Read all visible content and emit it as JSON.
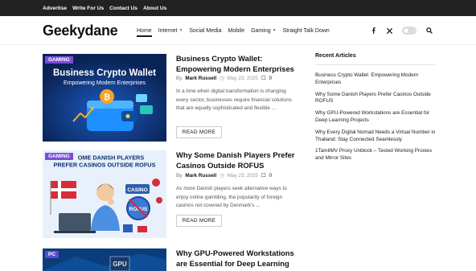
{
  "topbar": {
    "links": [
      "Advertise",
      "Write For Us",
      "Contact Us",
      "About Us"
    ]
  },
  "header": {
    "logo": "Geekydane",
    "nav": [
      {
        "label": "Home",
        "active": true,
        "dropdown": false
      },
      {
        "label": "Internet",
        "active": false,
        "dropdown": true
      },
      {
        "label": "Social Media",
        "active": false,
        "dropdown": false
      },
      {
        "label": "Mobile",
        "active": false,
        "dropdown": false
      },
      {
        "label": "Gaming",
        "active": false,
        "dropdown": true
      },
      {
        "label": "Straight Talk Down",
        "active": false,
        "dropdown": false
      }
    ],
    "icons": [
      "facebook-icon",
      "x-icon",
      "theme-toggle",
      "search-icon"
    ]
  },
  "posts": [
    {
      "category": "GAMING",
      "thumb_heading": "Business Crypto Wallet",
      "thumb_sub": "Empowering Modern Enterprises",
      "title": "Business Crypto Wallet: Empowering Modern Enterprises",
      "by": "By",
      "author": "Mark Russell",
      "date": "May 23, 2025",
      "comments": "0",
      "excerpt": "In a time when digital transformation is changing every sector, businesses require financial solutions that are equally sophisticated and flexible ...",
      "read_more": "READ MORE"
    },
    {
      "category": "GAMING",
      "thumb_heading": "OME DANISH PLAYERS PREFER CASINOS OUTSIDE ROFUS",
      "thumb_badge": "CASINO",
      "thumb_badge2": "ROFUS",
      "title": "Why Some Danish Players Prefer Casinos Outside ROFUS",
      "by": "By",
      "author": "Mark Russell",
      "date": "May 23, 2025",
      "comments": "0",
      "excerpt": "As more Danish players seek alternative ways to enjoy online gambling, the popularity of foreign casinos not covered by Denmark's ...",
      "read_more": "READ MORE"
    },
    {
      "category": "PC",
      "thumb_label": "GPU",
      "title": "Why GPU-Powered Workstations are Essential for Deep Learning"
    }
  ],
  "sidebar": {
    "title": "Recent Articles",
    "items": [
      "Business Crypto Wallet: Empowering Modern Enterprises",
      "Why Some Danish Players Prefer Casinos Outside ROFUS",
      "Why GPU-Powered Workstations are Essential for Deep Learning Projects",
      "Why Every Digital Nomad Needs a Virtual Number in Thailand: Stay Connected Seamlessly",
      "1TamilMV Proxy Unblock – Tested Working Proxies and Mirror Sites"
    ]
  },
  "colors": {
    "topbar_bg": "#222222",
    "category_badge": "#7b4dd6",
    "thumb1_bg": "#0f2f6b",
    "thumb2_bg": "#e8f1fb",
    "thumb3_bg": "#0b3d7a"
  }
}
